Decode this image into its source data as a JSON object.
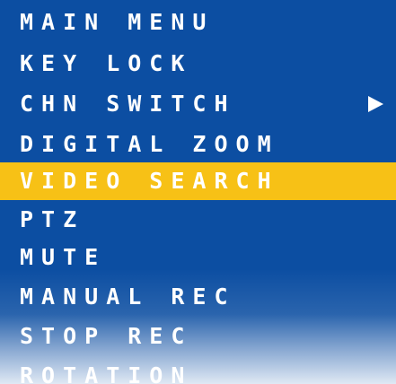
{
  "menu": {
    "items": [
      {
        "label": "MAIN MENU"
      },
      {
        "label": "KEY LOCK"
      },
      {
        "label": "CHN SWITCH",
        "submenu_indicator": "right-triangle-icon"
      },
      {
        "label": "DIGITAL ZOOM"
      },
      {
        "label": "VIDEO SEARCH",
        "selected": true
      },
      {
        "label": "PTZ"
      },
      {
        "label": "MUTE"
      },
      {
        "label": "MANUAL REC"
      },
      {
        "label": "STOP REC"
      },
      {
        "label": "ROTATION"
      }
    ]
  },
  "colors": {
    "background": "#0c4ea2",
    "selection": "#f7c116",
    "text": "#ffffff"
  }
}
